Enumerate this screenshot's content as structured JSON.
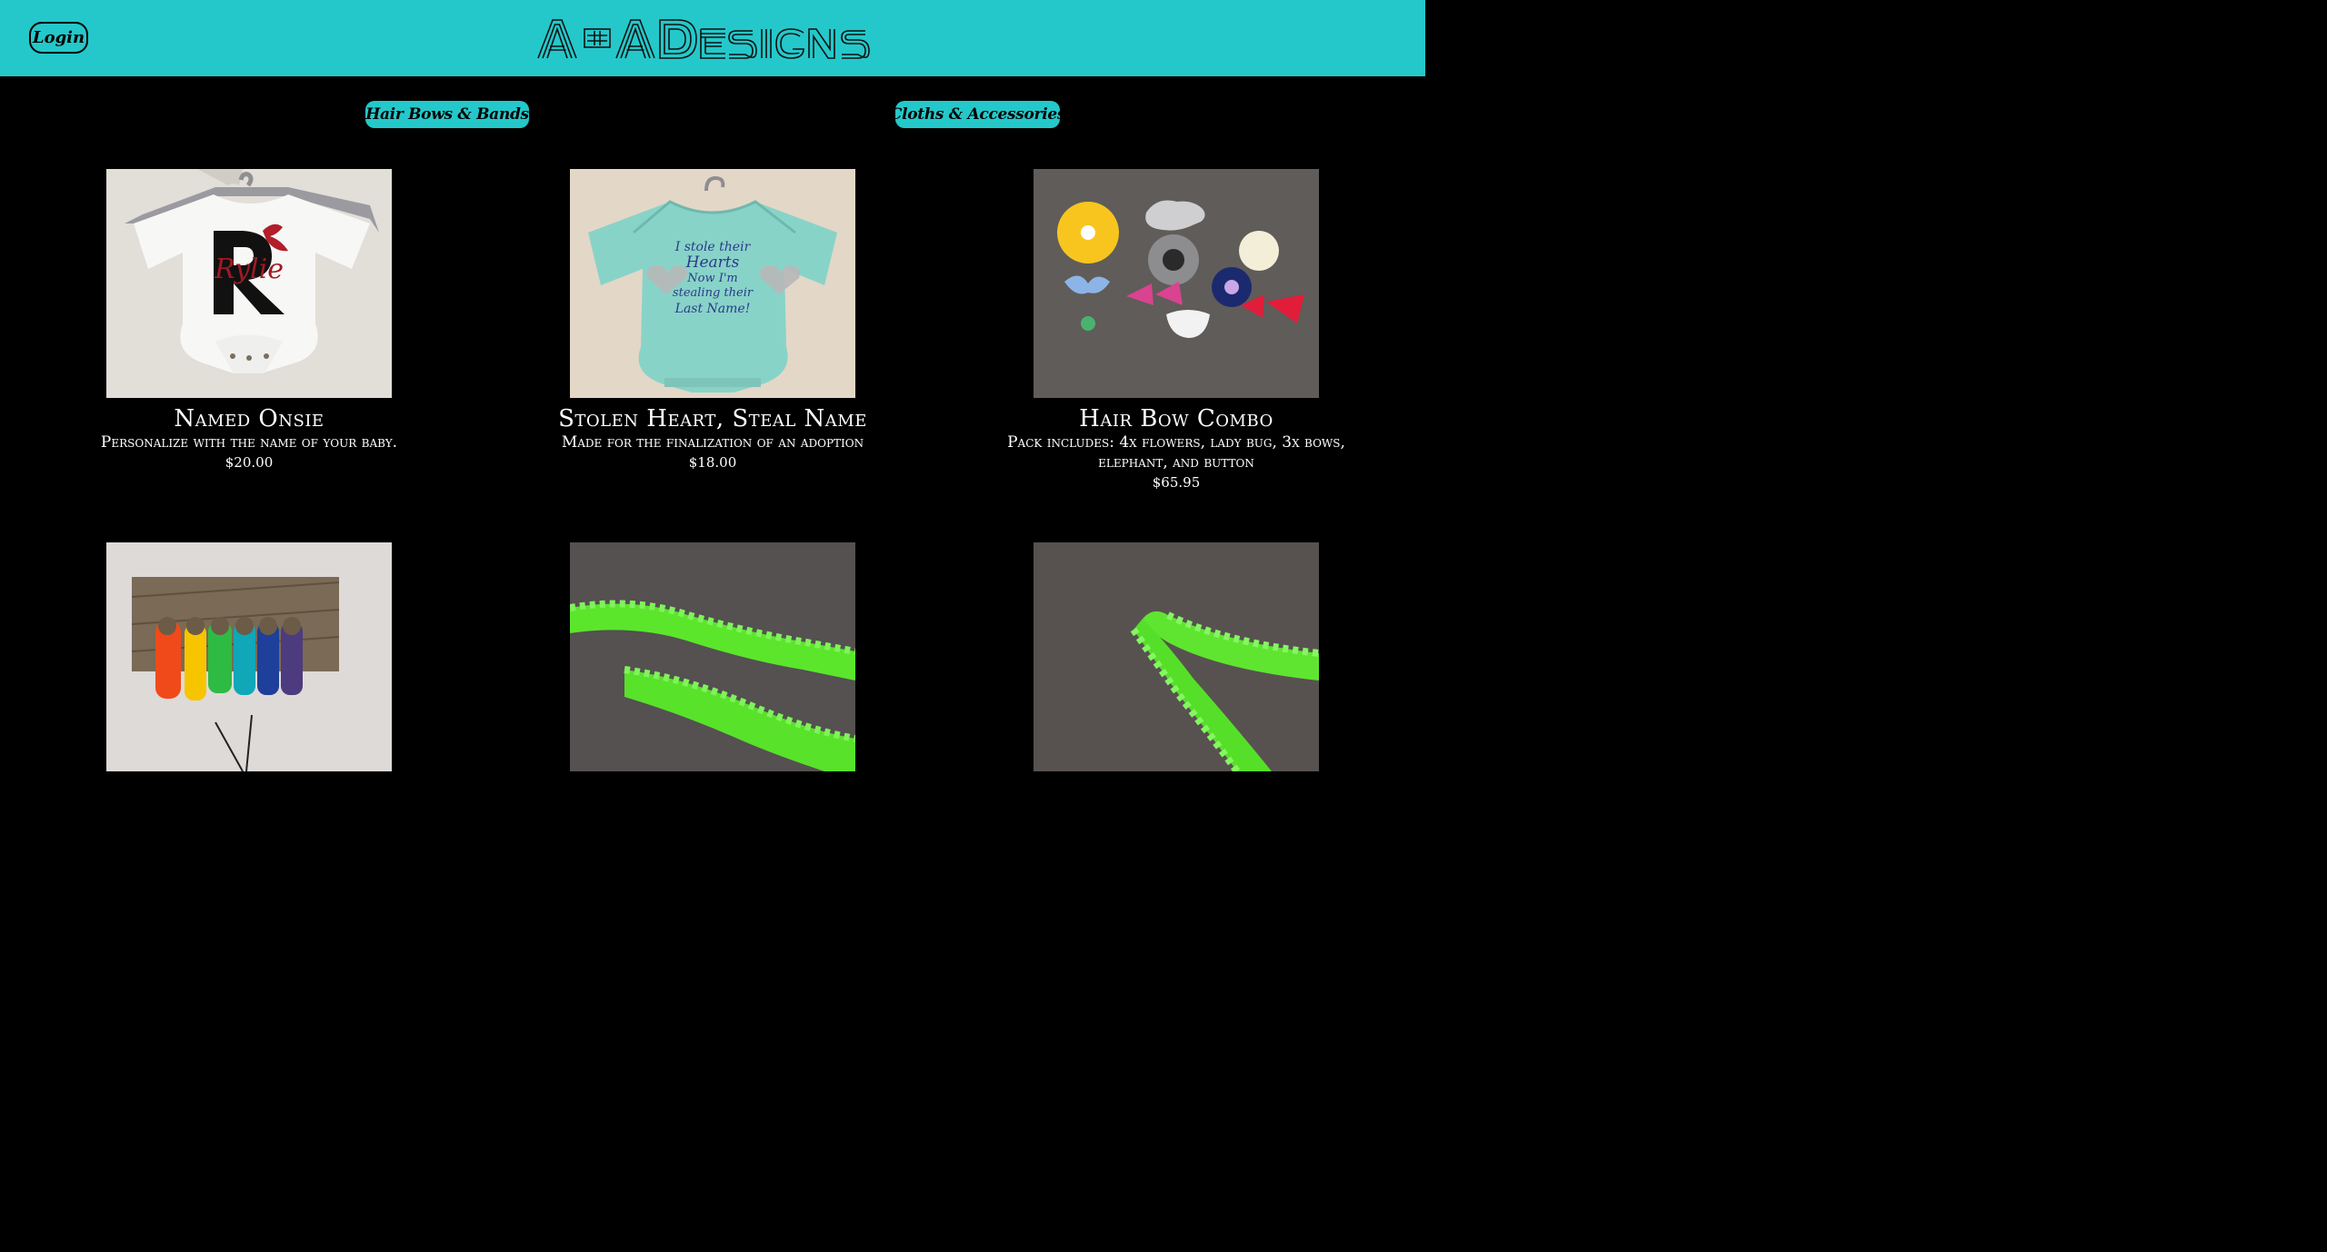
{
  "header": {
    "login_label": "Login",
    "brand": "A+A Designs",
    "background_color": "#24c8ca"
  },
  "categories": [
    {
      "label": "Hair Bows & Bands"
    },
    {
      "label": "Cloths & Accessories"
    }
  ],
  "products": [
    {
      "name": "Named Onsie",
      "description": "Personalize with the name of your baby.",
      "price": "$20.00",
      "photo_icon": "white-onesie-photo",
      "photo_text": "Rylie"
    },
    {
      "name": "Stolen Heart, Steal Name",
      "description": "Made for the finalization of an adoption",
      "price": "$18.00",
      "photo_icon": "teal-onesie-photo",
      "photo_text": "I stole their Hearts Now I'm stealing their Last Name!"
    },
    {
      "name": "Hair Bow Combo",
      "description": "Pack includes: 4x flowers, lady bug, 3x bows, elephant, and button",
      "price": "$65.95",
      "photo_icon": "hair-bows-photo"
    },
    {
      "photo_icon": "headbands-rack-photo"
    },
    {
      "photo_icon": "green-headband-photo"
    },
    {
      "photo_icon": "green-headband-closeup-photo"
    }
  ]
}
